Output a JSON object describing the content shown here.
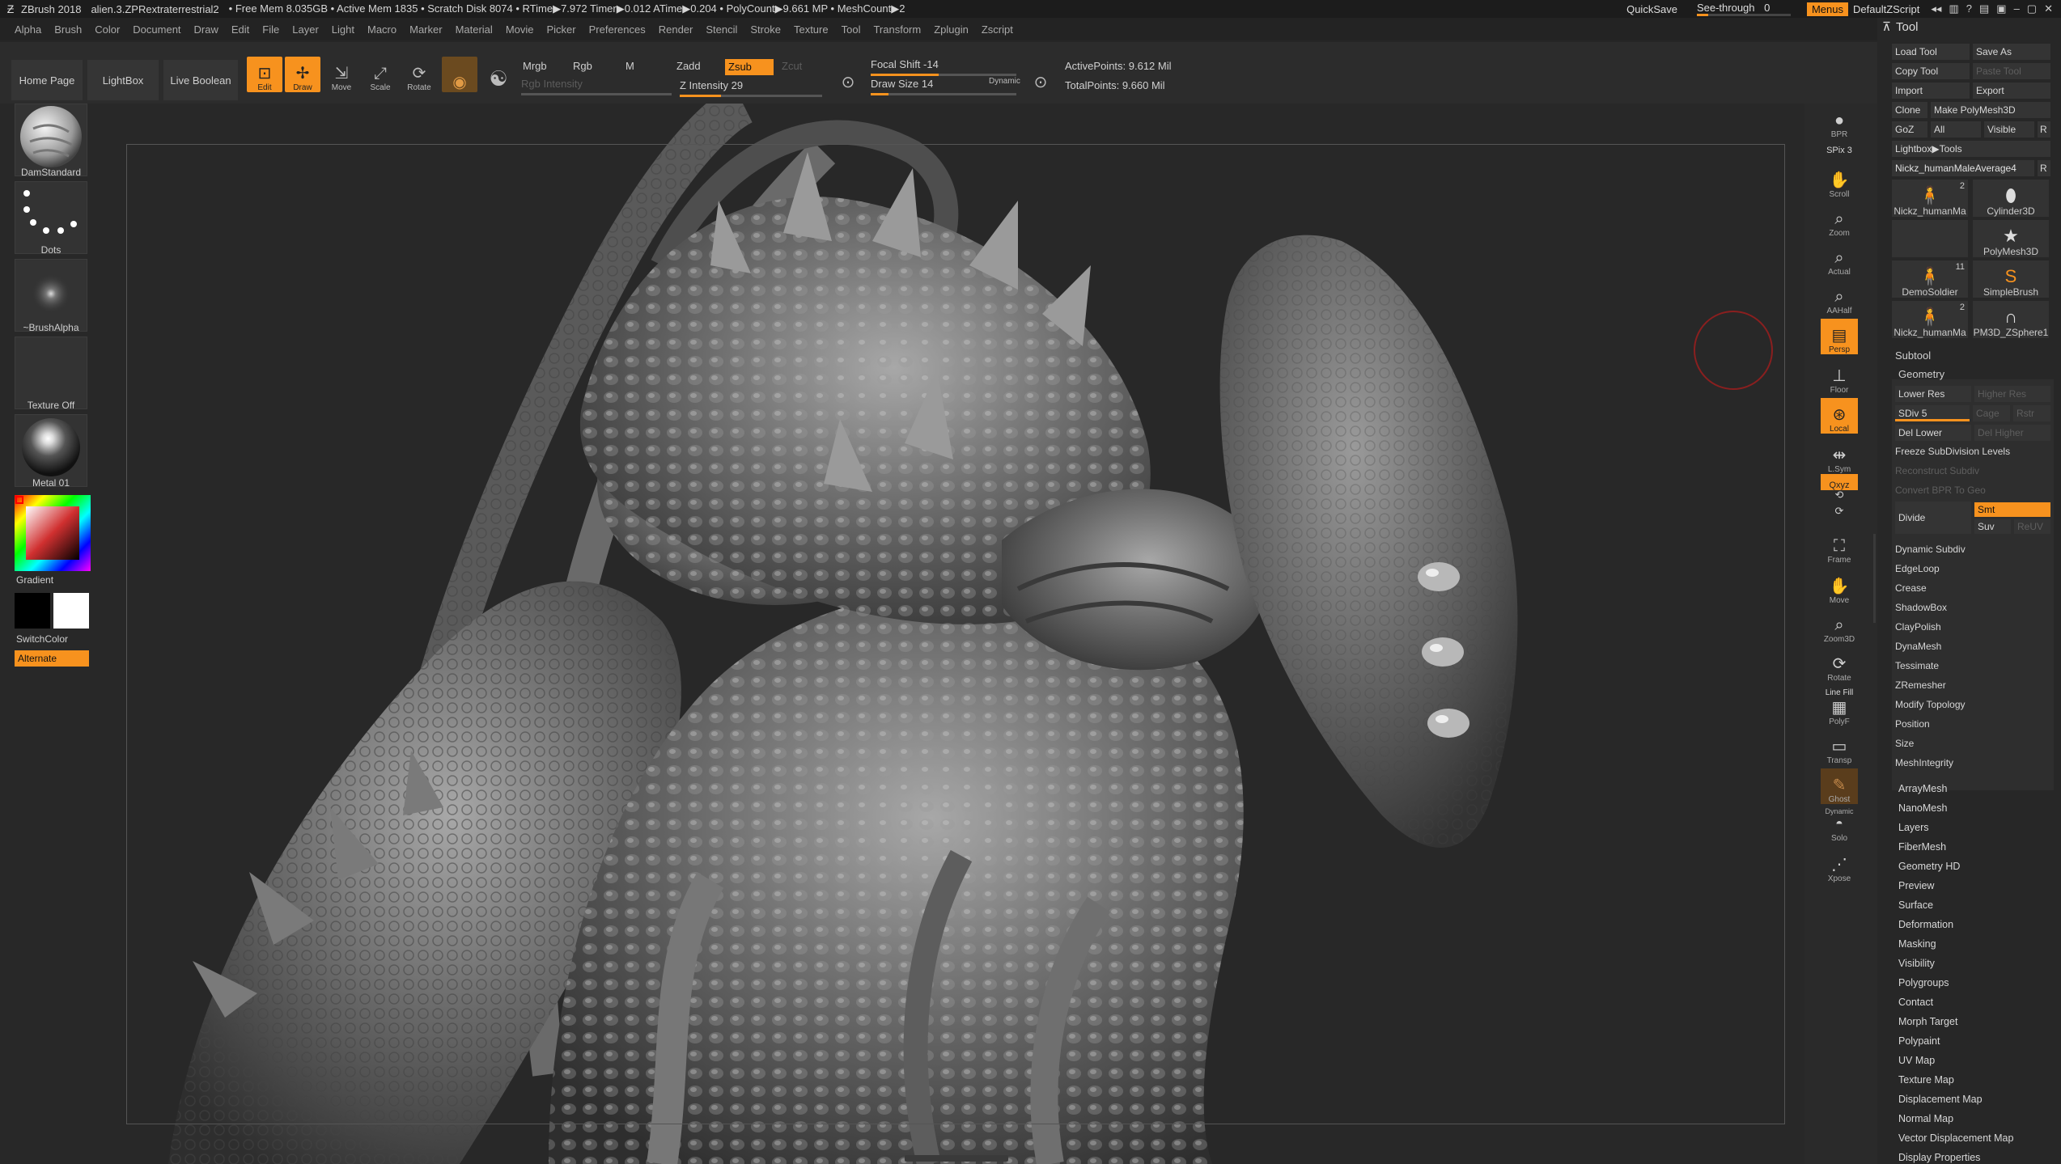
{
  "titlebar": {
    "app": "ZBrush 2018",
    "document": "alien.3.ZPRextraterrestrial2",
    "stats": "• Free Mem 8.035GB • Active Mem 1835 • Scratch Disk 8074 •  RTime▶7.972 Timer▶0.012 ATime▶0.204 • PolyCount▶9.661 MP  • MeshCount▶2",
    "quicksave": "QuickSave",
    "see_through_label": "See-through",
    "see_through_value": "0",
    "see_through_level": 0,
    "menus": "Menus",
    "script": "DefaultZScript"
  },
  "menubar": [
    "Alpha",
    "Brush",
    "Color",
    "Document",
    "Draw",
    "Edit",
    "File",
    "Layer",
    "Light",
    "Macro",
    "Marker",
    "Material",
    "Movie",
    "Picker",
    "Preferences",
    "Render",
    "Stencil",
    "Stroke",
    "Texture",
    "Tool",
    "Transform",
    "Zplugin",
    "Zscript"
  ],
  "shelf": {
    "home_page": "Home Page",
    "lightbox": "LightBox",
    "live_boolean": "Live Boolean",
    "edit": "Edit",
    "draw": "Draw",
    "move": "Move",
    "scale": "Scale",
    "rotate": "Rotate",
    "mrgb": "Mrgb",
    "rgb": "Rgb",
    "m": "M",
    "rgb_intensity": "Rgb Intensity",
    "zadd": "Zadd",
    "zsub": "Zsub",
    "zcut": "Zcut",
    "z_intensity_label": "Z Intensity",
    "z_intensity_value": "29",
    "z_intensity_level": 29,
    "focal_shift_label": "Focal Shift",
    "focal_shift_value": "-14",
    "draw_size_label": "Draw Size",
    "draw_size_value": "14",
    "dynamic": "Dynamic",
    "active_points": "ActivePoints: 9.612 Mil",
    "total_points": "TotalPoints: 9.660 Mil"
  },
  "lefttray": {
    "brush": "DamStandard",
    "stroke": "Dots",
    "alpha": "~BrushAlpha",
    "texture": "Texture Off",
    "material": "Metal 01",
    "gradient": "Gradient",
    "switchcolor": "SwitchColor",
    "alternate": "Alternate"
  },
  "rightshelf": {
    "bpr": "BPR",
    "spix_label": "SPix",
    "spix_value": "3",
    "scroll": "Scroll",
    "zoom": "Zoom",
    "actual": "Actual",
    "aahalf": "AAHalf",
    "persp": "Persp",
    "floor": "Floor",
    "local": "Local",
    "lsym": "L.Sym",
    "xyz": "Qxyz",
    "frame": "Frame",
    "move": "Move",
    "zoom3d": "Zoom3D",
    "rotate": "Rotate",
    "line_fill": "Line Fill",
    "polyf": "PolyF",
    "transp": "Transp",
    "ghost": "Ghost",
    "dynamic": "Dynamic",
    "solo": "Solo",
    "xpose": "Xpose"
  },
  "tool": {
    "title": "Tool",
    "load_tool": "Load Tool",
    "save_as": "Save As",
    "copy_tool": "Copy Tool",
    "paste_tool": "Paste Tool",
    "import": "Import",
    "export": "Export",
    "clone": "Clone",
    "make_polymesh": "Make PolyMesh3D",
    "goz": "GoZ",
    "all": "All",
    "visible": "Visible",
    "r": "R",
    "lightbox_tools": "Lightbox▶Tools",
    "current_tool": "Nickz_humanMaleAverage4",
    "thumbs": [
      {
        "label": "Nickz_humanMa",
        "badge": "2",
        "icon": "human"
      },
      {
        "label": "Cylinder3D",
        "badge": "",
        "icon": "cylinder"
      },
      {
        "label": "",
        "badge": "",
        "icon": "none"
      },
      {
        "label": "PolyMesh3D",
        "badge": "",
        "icon": "star"
      },
      {
        "label": "DemoSoldier",
        "badge": "11",
        "icon": "human"
      },
      {
        "label": "SimpleBrush",
        "badge": "",
        "icon": "s"
      },
      {
        "label": "Nickz_humanMa",
        "badge": "2",
        "icon": "human"
      },
      {
        "label": "PM3D_ZSphere1",
        "badge": "",
        "icon": "curve"
      }
    ],
    "subtool": "Subtool",
    "geometry": "Geometry",
    "lower_res": "Lower Res",
    "higher_res": "Higher Res",
    "sdiv_label": "SDiv",
    "sdiv_value": "5",
    "cage": "Cage",
    "rstr": "Rstr",
    "del_lower": "Del Lower",
    "del_higher": "Del Higher",
    "freeze": "Freeze SubDivision Levels",
    "reconstruct": "Reconstruct Subdiv",
    "convert_bpr": "Convert BPR To Geo",
    "divide": "Divide",
    "smt": "Smt",
    "suv": "Suv",
    "reuv": "ReUV",
    "geometry_items": [
      "Dynamic Subdiv",
      "EdgeLoop",
      "Crease",
      "ShadowBox",
      "ClayPolish",
      "DynaMesh",
      "Tessimate",
      "ZRemesher",
      "Modify Topology",
      "Position",
      "Size",
      "MeshIntegrity"
    ],
    "sub_palettes": [
      "ArrayMesh",
      "NanoMesh",
      "Layers",
      "FiberMesh",
      "Geometry HD",
      "Preview",
      "Surface",
      "Deformation",
      "Masking",
      "Visibility",
      "Polygroups",
      "Contact",
      "Morph Target",
      "Polypaint",
      "UV Map",
      "Texture Map",
      "Displacement Map",
      "Normal Map",
      "Vector Displacement Map",
      "Display Properties"
    ]
  }
}
